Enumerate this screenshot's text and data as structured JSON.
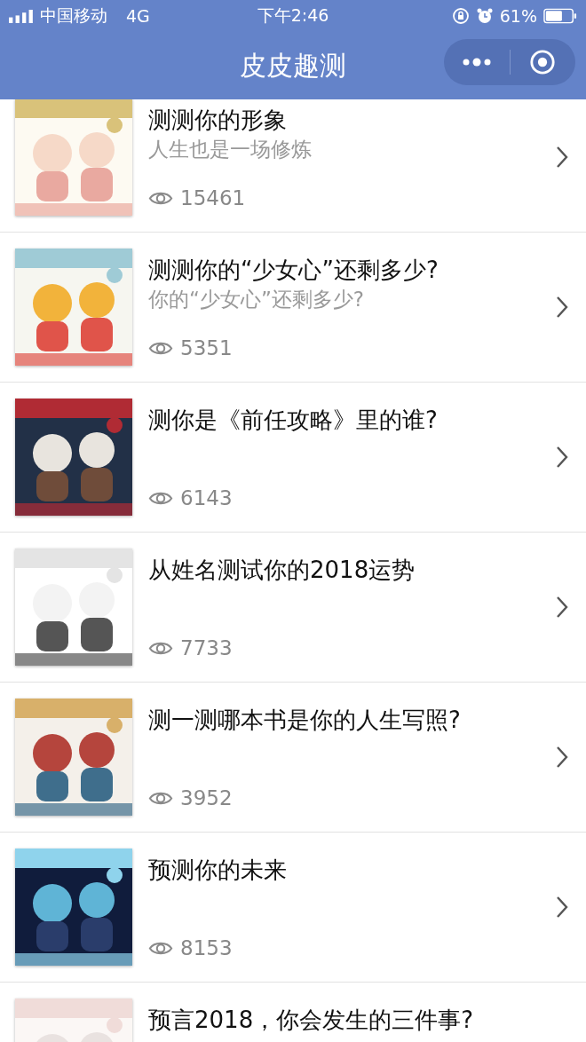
{
  "status_bar": {
    "carrier": "中国移动",
    "network": "4G",
    "time": "下午2:46",
    "battery": "61%"
  },
  "nav": {
    "title": "皮皮趣测"
  },
  "items": [
    {
      "title": "测测你的形象",
      "subtitle": "人生也是一场修炼",
      "views": "15461"
    },
    {
      "title": "测测你的“少女心”还剩多少?",
      "subtitle": "你的“少女心”还剩多少?",
      "views": "5351"
    },
    {
      "title": "测你是《前任攻略》里的谁?",
      "views": "6143"
    },
    {
      "title": "从姓名测试你的2018运势",
      "views": "7733"
    },
    {
      "title": "测一测哪本书是你的人生写照?",
      "views": "3952"
    },
    {
      "title": "预测你的未来",
      "views": "8153"
    },
    {
      "title": "预言2018，你会发生的三件事?"
    }
  ]
}
